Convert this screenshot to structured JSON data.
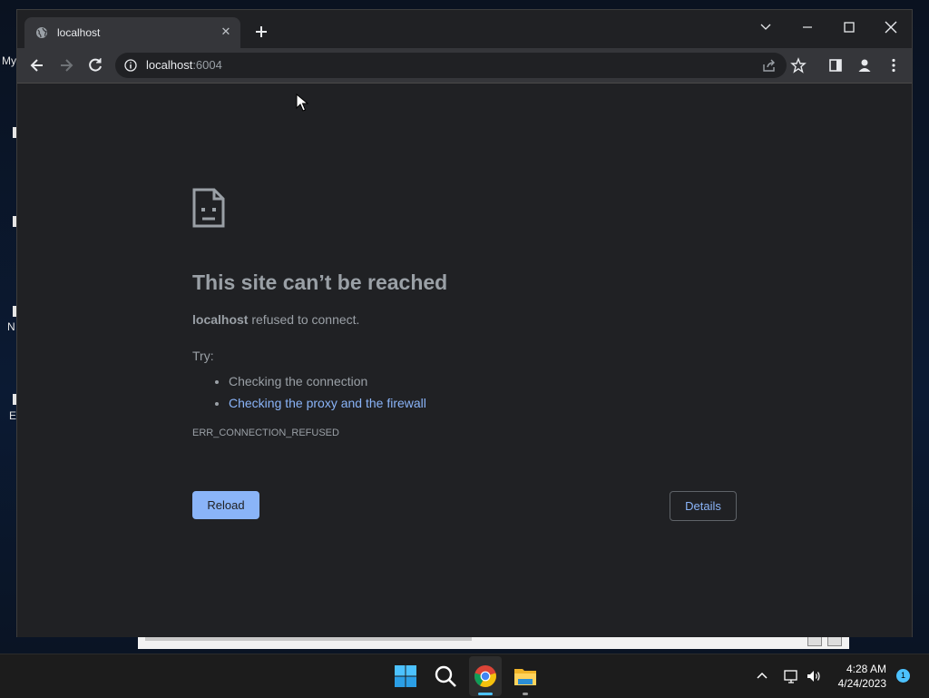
{
  "desktop": {
    "fragments": [
      "My",
      "N",
      "E"
    ]
  },
  "tab": {
    "title": "localhost",
    "close_symbol": "✕"
  },
  "omnibox": {
    "host": "localhost",
    "port": ":6004"
  },
  "error": {
    "title": "This site can’t be reached",
    "host": "localhost",
    "message": " refused to connect.",
    "try_label": "Try:",
    "suggestions": [
      "Checking the connection",
      "Checking the proxy and the firewall"
    ],
    "code": "ERR_CONNECTION_REFUSED",
    "reload_label": "Reload",
    "details_label": "Details"
  },
  "taskbar": {
    "time": "4:28 AM",
    "date": "4/24/2023",
    "notification_count": "1"
  },
  "colors": {
    "page_bg": "#202124",
    "toolbar_bg": "#35363a",
    "accent": "#8ab4f8",
    "text_muted": "#9aa0a6"
  },
  "icons": [
    "globe-icon",
    "close-icon",
    "plus-icon",
    "chevron-down-icon",
    "minimize-icon",
    "maximize-icon",
    "back-icon",
    "forward-icon",
    "reload-icon",
    "info-icon",
    "share-icon",
    "star-icon",
    "sidepanel-icon",
    "profile-icon",
    "more-icon",
    "sad-page-icon",
    "windows-start-icon",
    "search-icon",
    "chrome-icon",
    "file-explorer-icon",
    "chevron-up-icon",
    "network-icon",
    "volume-icon"
  ]
}
